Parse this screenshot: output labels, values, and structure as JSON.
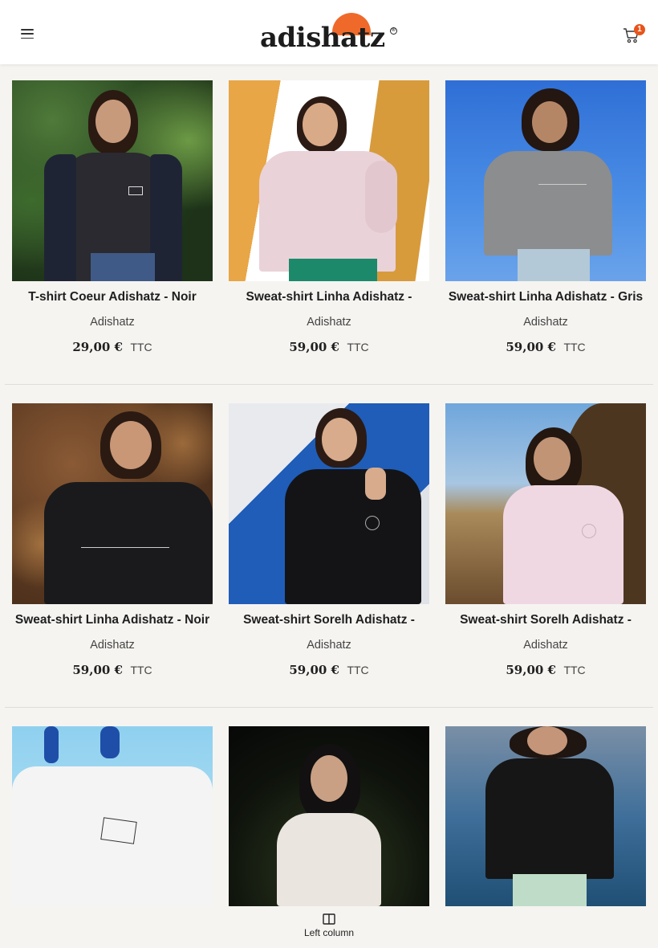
{
  "header": {
    "logo_text": "adishatz",
    "logo_reg": "®",
    "cart_count": "1"
  },
  "products": [
    {
      "title": "T-shirt Coeur Adishatz - Noir",
      "brand": "Adishatz",
      "price": "29,00 €",
      "tax": "TTC"
    },
    {
      "title": "Sweat-shirt Linha Adishatz -",
      "brand": "Adishatz",
      "price": "59,00 €",
      "tax": "TTC"
    },
    {
      "title": "Sweat-shirt Linha Adishatz - Gris",
      "brand": "Adishatz",
      "price": "59,00 €",
      "tax": "TTC"
    },
    {
      "title": "Sweat-shirt Linha Adishatz - Noir",
      "brand": "Adishatz",
      "price": "59,00 €",
      "tax": "TTC"
    },
    {
      "title": "Sweat-shirt Sorelh Adishatz -",
      "brand": "Adishatz",
      "price": "59,00 €",
      "tax": "TTC"
    },
    {
      "title": "Sweat-shirt Sorelh Adishatz -",
      "brand": "Adishatz",
      "price": "59,00 €",
      "tax": "TTC"
    }
  ],
  "bottom_bar": {
    "left_column_label": "Left column"
  },
  "colors": {
    "accent": "#ef6a2a",
    "badge": "#e8541b",
    "background": "#f5f4f1"
  }
}
